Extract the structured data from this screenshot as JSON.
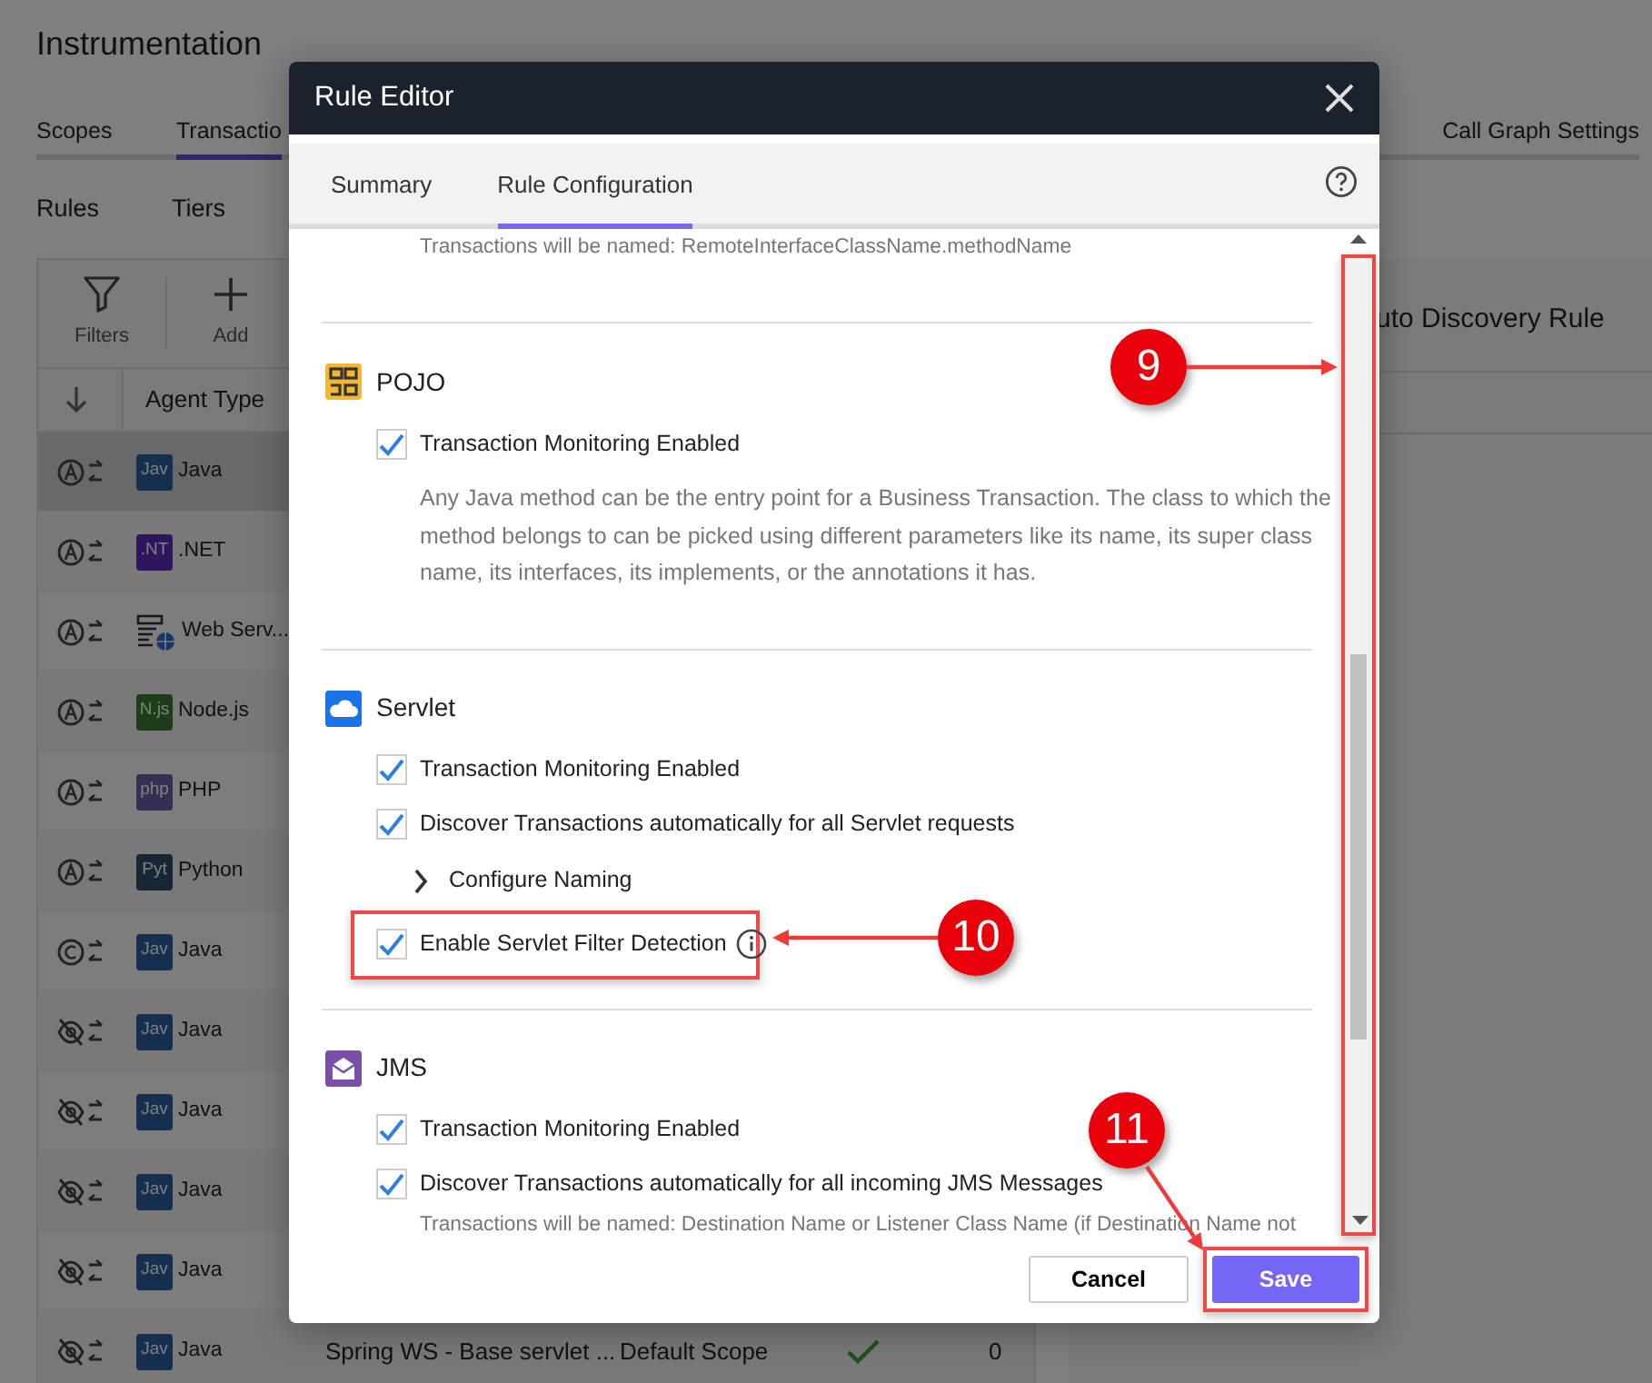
{
  "page": {
    "title": "Instrumentation",
    "tabs": [
      {
        "label": "Scopes",
        "selected": false
      },
      {
        "label": "Transactio",
        "selected": true
      },
      {
        "label": "Call Graph Settings",
        "selected": false
      }
    ],
    "subtabs": [
      "Rules",
      "Tiers"
    ],
    "toolbar": [
      {
        "kind": "filter",
        "label": "Filters"
      },
      {
        "kind": "add",
        "label": "Add"
      }
    ],
    "table": {
      "columns": [
        "Agent Type"
      ],
      "rows": [
        {
          "status": {
            "kind": "auto"
          },
          "agent": {
            "kind": "java",
            "badge": "Jav"
          },
          "agent_type": "Java",
          "selected": true
        },
        {
          "status": {
            "kind": "auto"
          },
          "agent": {
            "kind": "dotnet",
            "badge": ".NT"
          },
          "agent_type": ".NET",
          "selected": false
        },
        {
          "status": {
            "kind": "auto"
          },
          "agent": {
            "kind": "webservice"
          },
          "agent_type": "Web Serv...",
          "selected": false
        },
        {
          "status": {
            "kind": "auto"
          },
          "agent": {
            "kind": "node",
            "badge": "N.js"
          },
          "agent_type": "Node.js",
          "selected": false
        },
        {
          "status": {
            "kind": "auto"
          },
          "agent": {
            "kind": "php",
            "badge": "php"
          },
          "agent_type": "PHP",
          "selected": false
        },
        {
          "status": {
            "kind": "auto"
          },
          "agent": {
            "kind": "python",
            "badge": "Pyt"
          },
          "agent_type": "Python",
          "selected": false
        },
        {
          "status": {
            "kind": "custom"
          },
          "agent": {
            "kind": "java",
            "badge": "Jav"
          },
          "agent_type": "Java",
          "selected": false
        },
        {
          "status": {
            "kind": "disabled"
          },
          "agent": {
            "kind": "java",
            "badge": "Jav"
          },
          "agent_type": "Java",
          "selected": false
        },
        {
          "status": {
            "kind": "disabled"
          },
          "agent": {
            "kind": "java",
            "badge": "Jav"
          },
          "agent_type": "Java",
          "selected": false
        },
        {
          "status": {
            "kind": "disabled"
          },
          "agent": {
            "kind": "java",
            "badge": "Jav"
          },
          "agent_type": "Java",
          "selected": false
        },
        {
          "status": {
            "kind": "disabled"
          },
          "agent": {
            "kind": "java",
            "badge": "Jav"
          },
          "agent_type": "Java",
          "selected": false
        },
        {
          "status": {
            "kind": "disabled"
          },
          "agent": {
            "kind": "java",
            "badge": "Jav"
          },
          "agent_type": "Java",
          "selected": false,
          "rule_name": "Spring WS - Base servlet ...",
          "scope": "Default Scope",
          "enabled": true,
          "count": "0"
        }
      ]
    },
    "side_panel": {
      "title": "uto Discovery Rule"
    }
  },
  "dialog": {
    "title": "Rule Editor",
    "tabs": [
      {
        "label": "Summary",
        "selected": false
      },
      {
        "label": "Rule Configuration",
        "selected": true
      }
    ],
    "top_note": "Transactions will be named: RemoteInterfaceClassName.methodName",
    "sections": [
      {
        "kind": "pojo",
        "name": "POJO",
        "items": [
          {
            "kind": "checkbox",
            "label": "Transaction Monitoring Enabled",
            "checked": true
          },
          {
            "kind": "description",
            "text": "Any Java method can be the entry point for a Business Transaction. The class to which the method belongs to can be picked using different parameters like its name, its super class name, its interfaces, its implements, or the annotations it has."
          }
        ]
      },
      {
        "kind": "servlet",
        "name": "Servlet",
        "items": [
          {
            "kind": "checkbox",
            "label": "Transaction Monitoring Enabled",
            "checked": true
          },
          {
            "kind": "checkbox",
            "label": "Discover Transactions automatically for all Servlet requests",
            "checked": true
          },
          {
            "kind": "expander",
            "label": "Configure Naming",
            "expanded": false
          },
          {
            "kind": "checkbox",
            "label": "Enable Servlet Filter Detection",
            "checked": true,
            "info": true,
            "highlighted": true
          }
        ]
      },
      {
        "kind": "jms",
        "name": "JMS",
        "items": [
          {
            "kind": "checkbox",
            "label": "Transaction Monitoring Enabled",
            "checked": true
          },
          {
            "kind": "checkbox",
            "label": "Discover Transactions automatically for all incoming JMS Messages",
            "checked": true
          },
          {
            "kind": "note",
            "text": "Transactions will be named: Destination Name or Listener Class Name (if Destination Name not"
          }
        ]
      }
    ],
    "scrollbar": {
      "highlighted": true
    },
    "buttons": [
      {
        "kind": "cancel",
        "label": "Cancel",
        "highlighted": false
      },
      {
        "kind": "save",
        "label": "Save",
        "highlighted": true
      }
    ]
  },
  "callouts": [
    {
      "number": "9"
    },
    {
      "number": "10"
    },
    {
      "number": "11"
    }
  ]
}
